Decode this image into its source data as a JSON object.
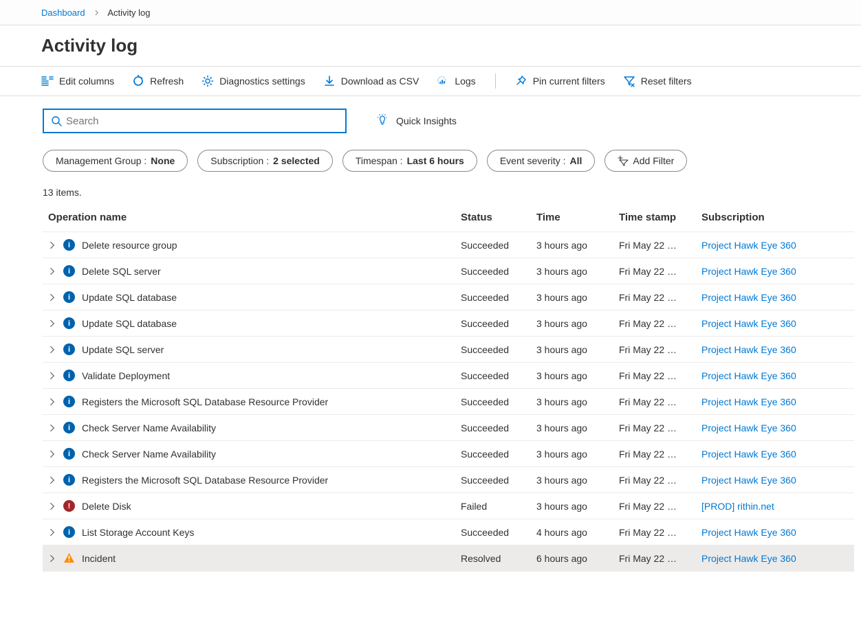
{
  "breadcrumb": {
    "root": "Dashboard",
    "current": "Activity log"
  },
  "page_title": "Activity log",
  "toolbar": {
    "edit_columns": "Edit columns",
    "refresh": "Refresh",
    "diagnostics": "Diagnostics settings",
    "download_csv": "Download as CSV",
    "logs": "Logs",
    "pin_filters": "Pin current filters",
    "reset_filters": "Reset filters"
  },
  "search": {
    "placeholder": "Search",
    "value": ""
  },
  "quick_insights_label": "Quick Insights",
  "filters": {
    "mgmt_group_label": "Management Group : ",
    "mgmt_group_value": "None",
    "subscription_label": "Subscription : ",
    "subscription_value": "2 selected",
    "timespan_label": "Timespan : ",
    "timespan_value": "Last 6 hours",
    "severity_label": "Event severity : ",
    "severity_value": "All",
    "add_filter": "Add Filter"
  },
  "items_count_text": "13 items.",
  "columns": {
    "operation": "Operation name",
    "status": "Status",
    "time": "Time",
    "timestamp": "Time stamp",
    "subscription": "Subscription"
  },
  "rows": [
    {
      "sev": "info",
      "op": "Delete resource group",
      "status": "Succeeded",
      "time": "3 hours ago",
      "ts": "Fri May 22 …",
      "sub": "Project Hawk Eye 360",
      "sel": false
    },
    {
      "sev": "info",
      "op": "Delete SQL server",
      "status": "Succeeded",
      "time": "3 hours ago",
      "ts": "Fri May 22 …",
      "sub": "Project Hawk Eye 360",
      "sel": false
    },
    {
      "sev": "info",
      "op": "Update SQL database",
      "status": "Succeeded",
      "time": "3 hours ago",
      "ts": "Fri May 22 …",
      "sub": "Project Hawk Eye 360",
      "sel": false
    },
    {
      "sev": "info",
      "op": "Update SQL database",
      "status": "Succeeded",
      "time": "3 hours ago",
      "ts": "Fri May 22 …",
      "sub": "Project Hawk Eye 360",
      "sel": false
    },
    {
      "sev": "info",
      "op": "Update SQL server",
      "status": "Succeeded",
      "time": "3 hours ago",
      "ts": "Fri May 22 …",
      "sub": "Project Hawk Eye 360",
      "sel": false
    },
    {
      "sev": "info",
      "op": "Validate Deployment",
      "status": "Succeeded",
      "time": "3 hours ago",
      "ts": "Fri May 22 …",
      "sub": "Project Hawk Eye 360",
      "sel": false
    },
    {
      "sev": "info",
      "op": "Registers the Microsoft SQL Database Resource Provider",
      "status": "Succeeded",
      "time": "3 hours ago",
      "ts": "Fri May 22 …",
      "sub": "Project Hawk Eye 360",
      "sel": false
    },
    {
      "sev": "info",
      "op": "Check Server Name Availability",
      "status": "Succeeded",
      "time": "3 hours ago",
      "ts": "Fri May 22 …",
      "sub": "Project Hawk Eye 360",
      "sel": false
    },
    {
      "sev": "info",
      "op": "Check Server Name Availability",
      "status": "Succeeded",
      "time": "3 hours ago",
      "ts": "Fri May 22 …",
      "sub": "Project Hawk Eye 360",
      "sel": false
    },
    {
      "sev": "info",
      "op": "Registers the Microsoft SQL Database Resource Provider",
      "status": "Succeeded",
      "time": "3 hours ago",
      "ts": "Fri May 22 …",
      "sub": "Project Hawk Eye 360",
      "sel": false
    },
    {
      "sev": "error",
      "op": "Delete Disk",
      "status": "Failed",
      "time": "3 hours ago",
      "ts": "Fri May 22 …",
      "sub": "[PROD] rithin.net",
      "sel": false
    },
    {
      "sev": "info",
      "op": "List Storage Account Keys",
      "status": "Succeeded",
      "time": "4 hours ago",
      "ts": "Fri May 22 …",
      "sub": "Project Hawk Eye 360",
      "sel": false
    },
    {
      "sev": "warn",
      "op": "Incident",
      "status": "Resolved",
      "time": "6 hours ago",
      "ts": "Fri May 22 …",
      "sub": "Project Hawk Eye 360",
      "sel": true
    }
  ]
}
